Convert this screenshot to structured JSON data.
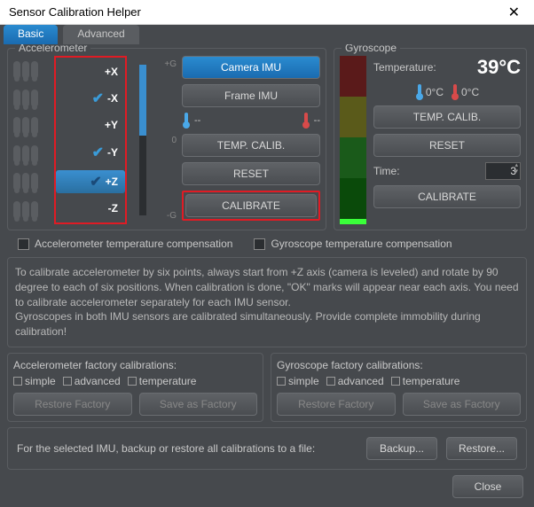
{
  "window": {
    "title": "Sensor Calibration Helper"
  },
  "tabs": {
    "basic": "Basic",
    "advanced": "Advanced"
  },
  "accel": {
    "title": "Accelerometer",
    "axes": [
      "+X",
      "-X",
      "+Y",
      "-Y",
      "+Z",
      "-Z"
    ],
    "checked": [
      false,
      true,
      false,
      true,
      true,
      false
    ],
    "selected": 4,
    "meter": {
      "top": "+G",
      "mid": "0",
      "bot": "-G"
    },
    "buttons": {
      "camera": "Camera IMU",
      "frame": "Frame IMU",
      "temp_dash1": "--",
      "temp_dash2": "--",
      "temp_calib": "TEMP. CALIB.",
      "reset": "RESET",
      "calibrate": "CALIBRATE"
    }
  },
  "gyro": {
    "title": "Gyroscope",
    "temp_label": "Temperature:",
    "temp_value": "39°C",
    "t1": "0°C",
    "t2": "0°C",
    "temp_calib": "TEMP. CALIB.",
    "reset": "RESET",
    "time_label": "Time:",
    "time_value": "3",
    "calibrate": "CALIBRATE"
  },
  "checks": {
    "accel_temp": "Accelerometer temperature compensation",
    "gyro_temp": "Gyroscope temperature compensation"
  },
  "instructions": "To calibrate accelerometer by six points, always start from +Z axis (camera is leveled) and rotate by 90 degree to each of six positions. When calibration is done, \"OK\" marks will appear near each axis. You need to calibrate accelerometer separately for each IMU sensor.\nGyroscopes in both IMU sensors are calibrated simultaneously. Provide complete immobility during calibration!",
  "factory": {
    "accel_title": "Accelerometer factory calibrations:",
    "gyro_title": "Gyroscope factory calibrations:",
    "simple": "simple",
    "advanced": "advanced",
    "temperature": "temperature",
    "restore": "Restore Factory",
    "save": "Save as Factory"
  },
  "backup": {
    "text": "For the selected IMU, backup or restore all calibrations to a file:",
    "backup_btn": "Backup...",
    "restore_btn": "Restore..."
  },
  "footer": {
    "close": "Close"
  }
}
